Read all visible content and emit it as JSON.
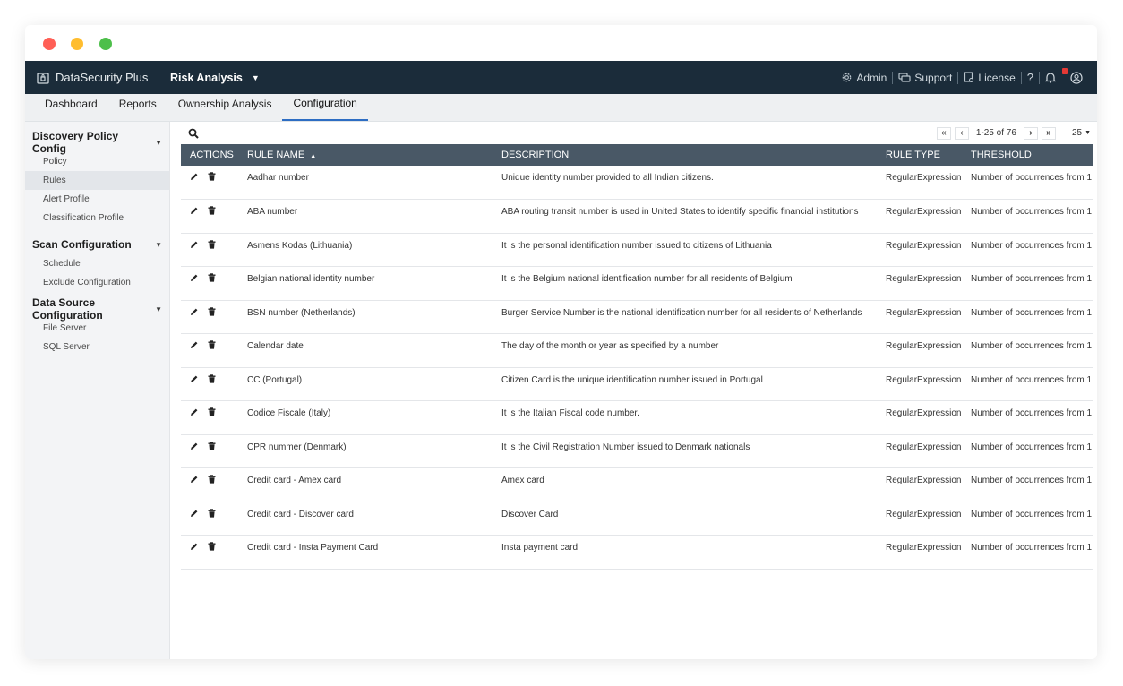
{
  "app": {
    "brand": "DataSecurity Plus",
    "module": "Risk Analysis"
  },
  "top_right": {
    "admin": "Admin",
    "support": "Support",
    "license": "License",
    "help": "?"
  },
  "tabs": [
    "Dashboard",
    "Reports",
    "Ownership Analysis",
    "Configuration"
  ],
  "active_tab": "Configuration",
  "sidebar": {
    "groups": [
      {
        "title": "Discovery Policy Config",
        "items": [
          "Policy",
          "Rules",
          "Alert Profile",
          "Classification Profile"
        ]
      },
      {
        "title": "Scan Configuration",
        "items": [
          "Schedule",
          "Exclude Configuration"
        ]
      },
      {
        "title": "Data Source Configuration",
        "items": [
          "File Server",
          "SQL Server"
        ]
      }
    ],
    "active_item": "Rules"
  },
  "pager": {
    "range": "1-25 of 76",
    "page_size": "25"
  },
  "table": {
    "headers": [
      "ACTIONS",
      "RULE NAME",
      "DESCRIPTION",
      "RULE TYPE",
      "THRESHOLD"
    ],
    "rows": [
      {
        "name": "Aadhar number",
        "description": "Unique identity number provided to all Indian citizens.",
        "type": "RegularExpression",
        "threshold": "Number of occurrences from 1"
      },
      {
        "name": "ABA number",
        "description": "ABA routing transit number is used in United States to identify specific financial institutions",
        "type": "RegularExpression",
        "threshold": "Number of occurrences from 1"
      },
      {
        "name": "Asmens Kodas (Lithuania)",
        "description": "It is the personal identification number issued to citizens of Lithuania",
        "type": "RegularExpression",
        "threshold": "Number of occurrences from 1"
      },
      {
        "name": "Belgian national identity number",
        "description": "It is the Belgium national identification number for all residents of Belgium",
        "type": "RegularExpression",
        "threshold": "Number of occurrences from 1"
      },
      {
        "name": "BSN number (Netherlands)",
        "description": "Burger Service Number is the national identification number for all residents of Netherlands",
        "type": "RegularExpression",
        "threshold": "Number of occurrences from 1"
      },
      {
        "name": "Calendar date",
        "description": "The day of the month or year as specified by a number",
        "type": "RegularExpression",
        "threshold": "Number of occurrences from 1"
      },
      {
        "name": "CC (Portugal)",
        "description": "Citizen Card is the unique identification number issued in Portugal",
        "type": "RegularExpression",
        "threshold": "Number of occurrences from 1"
      },
      {
        "name": "Codice Fiscale (Italy)",
        "description": "It is the Italian Fiscal code number.",
        "type": "RegularExpression",
        "threshold": "Number of occurrences from 1"
      },
      {
        "name": "CPR nummer (Denmark)",
        "description": "It is the Civil Registration Number issued to Denmark nationals",
        "type": "RegularExpression",
        "threshold": "Number of occurrences from 1"
      },
      {
        "name": "Credit card - Amex card",
        "description": "Amex card",
        "type": "RegularExpression",
        "threshold": "Number of occurrences from 1"
      },
      {
        "name": "Credit card - Discover card",
        "description": "Discover Card",
        "type": "RegularExpression",
        "threshold": "Number of occurrences from 1"
      },
      {
        "name": "Credit card - Insta Payment Card",
        "description": "Insta payment card",
        "type": "RegularExpression",
        "threshold": "Number of occurrences from 1"
      }
    ]
  },
  "colors": {
    "topnav": "#1b2c3a",
    "table_header": "#495866",
    "active_tab_underline": "#2d6dc3"
  }
}
